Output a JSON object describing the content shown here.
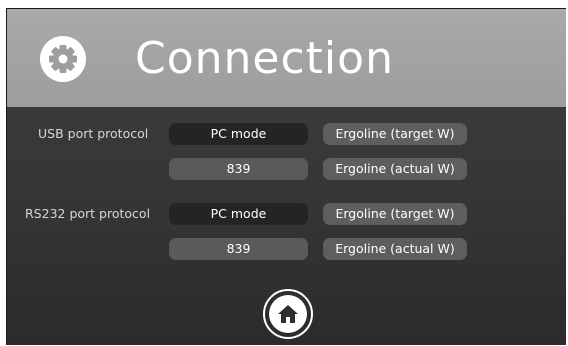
{
  "header": {
    "title": "Connection",
    "icon": "gear-icon"
  },
  "usb": {
    "label": "USB port protocol",
    "mode": "PC mode",
    "number": "839",
    "option_target": "Ergoline (target W)",
    "option_actual": "Ergoline (actual W)"
  },
  "rs232": {
    "label": "RS232 port protocol",
    "mode": "PC mode",
    "number": "839",
    "option_target": "Ergoline (target W)",
    "option_actual": "Ergoline (actual W)"
  },
  "footer": {
    "home_icon": "home-icon"
  },
  "colors": {
    "header_bg": "#a9a9a9",
    "body_bg": "#363636",
    "dark_field": "#242424",
    "gray_field": "#5e5e5e"
  }
}
